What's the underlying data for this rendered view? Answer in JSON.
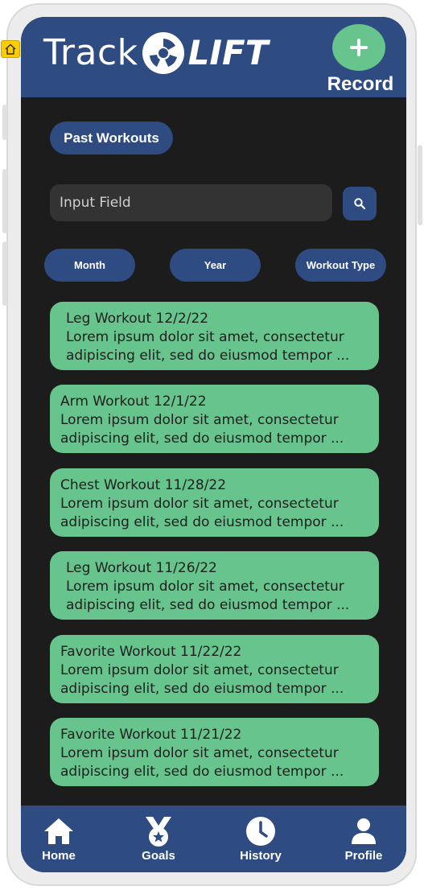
{
  "app": {
    "logo_text_1": "Track",
    "logo_text_2": "LIFT"
  },
  "header": {
    "record_label": "Record",
    "record_icon": "plus-icon"
  },
  "section": {
    "title": "Past Workouts"
  },
  "search": {
    "placeholder": "Input Field",
    "icon": "search-icon"
  },
  "filters": [
    {
      "label": "Month"
    },
    {
      "label": "Year"
    },
    {
      "label": "Workout Type"
    }
  ],
  "workouts": [
    {
      "title": "Leg Workout 12/2/22",
      "line1": "Lorem ipsum dolor sit amet, consectetur",
      "line2": "adipiscing elit, sed do eiusmod tempor ..."
    },
    {
      "title": "Arm Workout 12/1/22",
      "line1": "Lorem ipsum dolor sit amet, consectetur",
      "line2": "adipiscing elit, sed do eiusmod tempor ..."
    },
    {
      "title": "Chest Workout 11/28/22",
      "line1": "Lorem ipsum dolor sit amet, consectetur",
      "line2": "adipiscing elit, sed do eiusmod tempor ..."
    },
    {
      "title": "Leg Workout 11/26/22",
      "line1": "Lorem ipsum dolor sit amet, consectetur",
      "line2": "adipiscing elit, sed do eiusmod tempor ..."
    },
    {
      "title": "Favorite Workout 11/22/22",
      "line1": "Lorem ipsum dolor sit amet, consectetur",
      "line2": "adipiscing elit, sed do eiusmod tempor ..."
    },
    {
      "title": "Favorite Workout 11/21/22",
      "line1": "Lorem ipsum dolor sit amet, consectetur",
      "line2": "adipiscing elit, sed do eiusmod tempor ..."
    }
  ],
  "nav": [
    {
      "label": "Home",
      "icon": "home-icon"
    },
    {
      "label": "Goals",
      "icon": "medal-icon"
    },
    {
      "label": "History",
      "icon": "clock-icon"
    },
    {
      "label": "Profile",
      "icon": "user-icon"
    }
  ],
  "colors": {
    "primary": "#2e4b82",
    "accent": "#66c48c",
    "background": "#1c1c1c",
    "input": "#333333"
  }
}
